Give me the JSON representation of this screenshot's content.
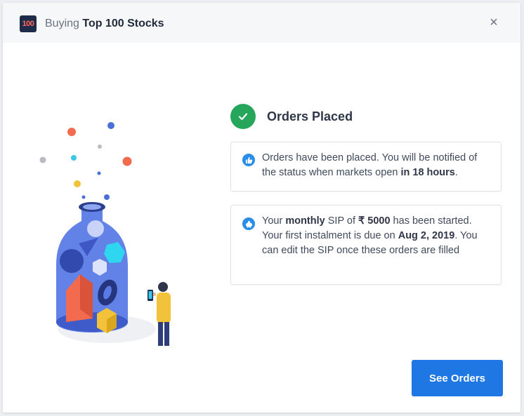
{
  "header": {
    "logo_text": "100",
    "title_prefix": "Buying",
    "title_main": "Top 100 Stocks",
    "close_icon": "×"
  },
  "status": {
    "icon": "check-icon",
    "label": "Orders Placed",
    "color": "#26a65b"
  },
  "cards": [
    {
      "icon": "thumbs-up-icon",
      "text_before": "Orders have been placed. You will be notified of the status when markets open ",
      "text_bold": "in 18 hours",
      "text_after": "."
    },
    {
      "icon": "piggy-bank-icon",
      "p1": "Your ",
      "b1": "monthly",
      "p2": " SIP of ",
      "b2": "₹ 5000",
      "p3": " has been started. Your first instalment is due on ",
      "b3": "Aug 2, 2019",
      "p4": ". You can edit the SIP once these orders are filled"
    }
  ],
  "actions": {
    "see_orders_label": "See Orders",
    "accent": "#1e77e3"
  }
}
